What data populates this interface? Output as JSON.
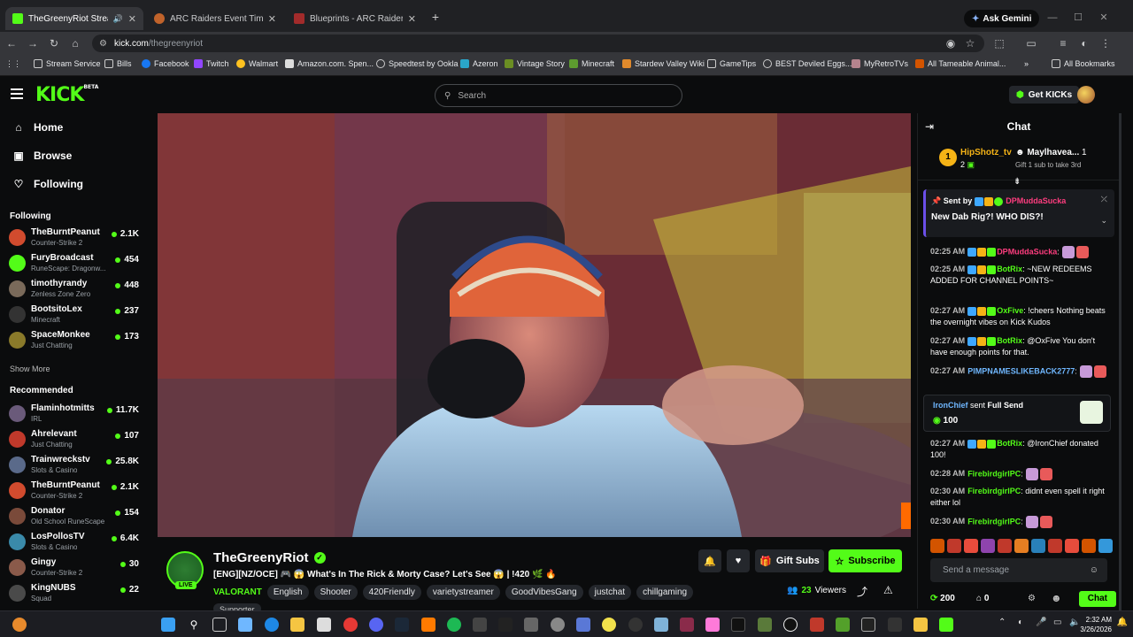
{
  "browser": {
    "tabs": [
      {
        "title": "TheGreenyRiot Stream - Wa",
        "active": true
      },
      {
        "title": "ARC Raiders Event Timers | Met",
        "active": false
      },
      {
        "title": "Blueprints - ARC Raiders Wiki",
        "active": false
      }
    ],
    "gemini_label": "Ask Gemini",
    "url_host": "kick.com",
    "url_path": "/thegreenyriot",
    "bookmarks": [
      "Stream Service",
      "Bills",
      "Facebook",
      "Twitch",
      "Walmart",
      "Amazon.com. Spen...",
      "Speedtest by Ookla",
      "Azeron",
      "Vintage Story",
      "Minecraft",
      "Stardew Valley Wiki",
      "GameTips",
      "BEST Deviled Eggs...",
      "MyRetroTVs",
      "All Tameable Animal...",
      "All Bookmarks"
    ]
  },
  "kick": {
    "logo": "KICK",
    "logo_badge": "BETA",
    "search_placeholder": "Search",
    "get_kicks": "Get KICKs"
  },
  "sidebar": {
    "nav": [
      {
        "label": "Home",
        "icon": "home-icon"
      },
      {
        "label": "Browse",
        "icon": "browse-icon"
      },
      {
        "label": "Following",
        "icon": "heart-icon"
      }
    ],
    "following_title": "Following",
    "following": [
      {
        "name": "TheBurntPeanut",
        "game": "Counter-Strike 2",
        "viewers": "2.1K",
        "color": "#d14b2e"
      },
      {
        "name": "FuryBroadcast",
        "game": "RuneScape: Dragonw...",
        "viewers": "454",
        "color": "#53fc18"
      },
      {
        "name": "timothyrandy",
        "game": "Zenless Zone Zero",
        "viewers": "448",
        "color": "#7a6a5a"
      },
      {
        "name": "BootsitoLex",
        "game": "Minecraft",
        "viewers": "237",
        "color": "#333333"
      },
      {
        "name": "SpaceMonkee",
        "game": "Just Chatting",
        "viewers": "173",
        "color": "#8a7a2a"
      }
    ],
    "show_more": "Show More",
    "recommended_title": "Recommended",
    "recommended": [
      {
        "name": "Flaminhotmitts",
        "game": "IRL",
        "viewers": "11.7K",
        "color": "#6a5a7a"
      },
      {
        "name": "Ahrelevant",
        "game": "Just Chatting",
        "viewers": "107",
        "color": "#c0392b"
      },
      {
        "name": "Trainwreckstv",
        "game": "Slots & Casino",
        "viewers": "25.8K",
        "color": "#5a6a8a"
      },
      {
        "name": "TheBurntPeanut",
        "game": "Counter-Strike 2",
        "viewers": "2.1K",
        "color": "#d14b2e"
      },
      {
        "name": "Donator",
        "game": "Old School RuneScape",
        "viewers": "154",
        "color": "#7a4a3a"
      },
      {
        "name": "LosPollosTV",
        "game": "Slots & Casino",
        "viewers": "6.4K",
        "color": "#3a8aaa"
      },
      {
        "name": "Gingy",
        "game": "Counter-Strike 2",
        "viewers": "30",
        "color": "#8a5a4a"
      },
      {
        "name": "KingNUBS",
        "game": "Squad",
        "viewers": "22",
        "color": "#4a4a4a"
      }
    ]
  },
  "stream": {
    "channel": "TheGreenyRiot",
    "live": "LIVE",
    "title": "[ENG][NZ/OCE] 🎮 😱 What's In The Rick & Morty Case? Let's See 😱 | !420 🌿 🔥",
    "category": "VALORANT",
    "tags": [
      "English",
      "Shooter",
      "420Friendly",
      "varietystreamer",
      "GoodVibesGang",
      "justchat",
      "chillgaming"
    ],
    "supporter": "Supporter",
    "gift_subs": "Gift Subs",
    "subscribe": "Subscribe",
    "viewers": "23",
    "viewers_label": "Viewers"
  },
  "chat": {
    "title": "Chat",
    "leaderboard": [
      {
        "rank": "1",
        "name": "HipShotz_tv",
        "count": "2"
      },
      {
        "name": "Maylhavea...",
        "count": "1",
        "note": "Gift 1 sub to take 3rd"
      }
    ],
    "pinned": {
      "sent_by": "Sent by",
      "user": "DPMuddaSucka",
      "text": "New Dab Rig?! WHO DIS?!"
    },
    "messages": [
      {
        "time": "02:25 AM",
        "user": "DPMuddaSucka",
        "color": "#ff3d7f",
        "text": ""
      },
      {
        "time": "02:25 AM",
        "user": "BotRix",
        "color": "#53fc18",
        "text": "~NEW REDEEMS ADDED FOR CHANNEL POINTS~"
      },
      {
        "time": "02:27 AM",
        "user": "OxFive",
        "color": "#53fc18",
        "text": "!cheers Nothing beats the overnight vibes on Kick Kudos"
      },
      {
        "time": "02:27 AM",
        "user": "BotRix",
        "color": "#53fc18",
        "text": "@OxFive You don't have enough points for that."
      },
      {
        "time": "02:27 AM",
        "user": "PIMPNAMESLIKEBACK2777",
        "color": "#6fb7ff",
        "text": ""
      }
    ],
    "gift": {
      "user": "IronChief",
      "action": "sent",
      "item": "Full Send",
      "amount": "100"
    },
    "messages2": [
      {
        "time": "02:27 AM",
        "user": "BotRix",
        "color": "#53fc18",
        "text": "@IronChief donated 100!"
      },
      {
        "time": "02:28 AM",
        "user": "FirebirdgirlPC",
        "color": "#53fc18",
        "text": ""
      },
      {
        "time": "02:30 AM",
        "user": "FirebirdgirlPC",
        "color": "#53fc18",
        "text": "didnt even spell it right either lol"
      },
      {
        "time": "02:30 AM",
        "user": "FirebirdgirlPC",
        "color": "#53fc18",
        "text": ""
      }
    ],
    "input_placeholder": "Send a message",
    "points": "200",
    "gifts": "0",
    "chat_button": "Chat"
  },
  "taskbar": {
    "time": "2:32 AM",
    "date": "3/26/2026"
  }
}
